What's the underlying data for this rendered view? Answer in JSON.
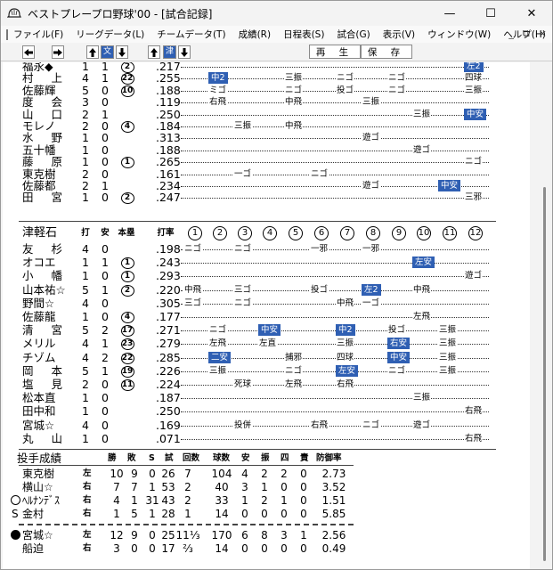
{
  "window": {
    "title": "ベストプレープロ野球'00 - [試合記録]",
    "minimize": "—",
    "maximize": "☐",
    "close": "✕"
  },
  "menu": [
    "ファイル(F)",
    "リーグデータ(L)",
    "チームデータ(T)",
    "成績(R)",
    "日程表(S)",
    "試合(G)",
    "表示(V)",
    "ウィンドウ(W)",
    "ヘルプ(H)"
  ],
  "mdi_controls": [
    "_",
    "⧉",
    "×"
  ],
  "toolbar": {
    "team1": "文",
    "team2": "津",
    "play": "再 生",
    "save": "保 存"
  },
  "top_batters": [
    {
      "name": "福永◆",
      "ab": "1",
      "h": "1",
      "hr": "2",
      "avg": ".217",
      "abs": [
        {
          "inn": 12,
          "t": "左2",
          "hl": true
        }
      ]
    },
    {
      "name": "村上",
      "ab": "4",
      "h": "1",
      "hr": "22",
      "avg": ".255",
      "abs": [
        {
          "inn": 2,
          "t": "中2",
          "hl": true
        },
        {
          "inn": 5,
          "t": "三振"
        },
        {
          "inn": 7,
          "t": "ニゴ"
        },
        {
          "inn": 9,
          "t": "ニゴ"
        },
        {
          "inn": 12,
          "t": "四球"
        }
      ]
    },
    {
      "name": "佐藤輝",
      "ab": "5",
      "h": "0",
      "hr": "10",
      "avg": ".188",
      "abs": [
        {
          "inn": 2,
          "t": "ミゴ"
        },
        {
          "inn": 5,
          "t": "ニゴ"
        },
        {
          "inn": 7,
          "t": "投ゴ"
        },
        {
          "inn": 9,
          "t": "ニゴ"
        },
        {
          "inn": 12,
          "t": "三振"
        }
      ]
    },
    {
      "name": "度会",
      "ab": "3",
      "h": "0",
      "hr": "",
      "avg": ".119",
      "abs": [
        {
          "inn": 2,
          "t": "右飛"
        },
        {
          "inn": 5,
          "t": "中飛"
        },
        {
          "inn": 8,
          "t": "三振"
        }
      ]
    },
    {
      "name": "山口",
      "ab": "2",
      "h": "1",
      "hr": "",
      "avg": ".250",
      "abs": [
        {
          "inn": 10,
          "t": "三振"
        },
        {
          "inn": 12,
          "t": "中安",
          "hl": true
        }
      ]
    },
    {
      "name": "モレノ",
      "ab": "2",
      "h": "0",
      "hr": "4",
      "avg": ".184",
      "abs": [
        {
          "inn": 3,
          "t": "三振"
        },
        {
          "inn": 5,
          "t": "中飛"
        }
      ]
    },
    {
      "name": "水野",
      "ab": "1",
      "h": "0",
      "hr": "",
      "avg": ".313",
      "abs": [
        {
          "inn": 8,
          "t": "遊ゴ"
        }
      ]
    },
    {
      "name": "五十幡",
      "ab": "1",
      "h": "0",
      "hr": "",
      "avg": ".188",
      "abs": [
        {
          "inn": 10,
          "t": "遊ゴ"
        }
      ]
    },
    {
      "name": "藤原",
      "ab": "1",
      "h": "0",
      "hr": "1",
      "avg": ".265",
      "abs": [
        {
          "inn": 12,
          "t": "ニゴ"
        }
      ]
    },
    {
      "name": "東克樹",
      "ab": "2",
      "h": "0",
      "hr": "",
      "avg": ".161",
      "abs": [
        {
          "inn": 3,
          "t": "一ゴ"
        },
        {
          "inn": 6,
          "t": "ニゴ"
        }
      ]
    },
    {
      "name": "佐藤都",
      "ab": "2",
      "h": "1",
      "hr": "",
      "avg": ".234",
      "abs": [
        {
          "inn": 8,
          "t": "遊ゴ"
        },
        {
          "inn": 11,
          "t": "中安",
          "hl": true
        }
      ]
    },
    {
      "name": "田宮",
      "ab": "1",
      "h": "0",
      "hr": "2",
      "avg": ".247",
      "abs": [
        {
          "inn": 12,
          "t": "三邪"
        }
      ]
    }
  ],
  "team2": {
    "name": "津軽石",
    "col_ab": "打",
    "col_h": "安",
    "col_hr": "本塁",
    "col_avg": "打率",
    "innings": [
      "1",
      "2",
      "3",
      "4",
      "5",
      "6",
      "7",
      "8",
      "9",
      "10",
      "11",
      "12"
    ]
  },
  "bottom_batters": [
    {
      "name": "友杉",
      "ab": "4",
      "h": "0",
      "hr": "",
      "avg": ".198",
      "abs": [
        {
          "inn": 1,
          "t": "ニゴ"
        },
        {
          "inn": 3,
          "t": "ニゴ"
        },
        {
          "inn": 6,
          "t": "一邪"
        },
        {
          "inn": 8,
          "t": "一邪"
        }
      ]
    },
    {
      "name": "オコエ",
      "ab": "1",
      "h": "1",
      "hr": "1",
      "avg": ".243",
      "abs": [
        {
          "inn": 10,
          "t": "左安",
          "hl": true
        }
      ]
    },
    {
      "name": "小幡",
      "ab": "1",
      "h": "0",
      "hr": "1",
      "avg": ".293",
      "abs": [
        {
          "inn": 12,
          "t": "遊ゴ"
        }
      ]
    },
    {
      "name": "山本祐☆",
      "ab": "5",
      "h": "1",
      "hr": "2",
      "avg": ".220",
      "abs": [
        {
          "inn": 1,
          "t": "中飛"
        },
        {
          "inn": 3,
          "t": "三ゴ"
        },
        {
          "inn": 6,
          "t": "投ゴ"
        },
        {
          "inn": 8,
          "t": "左2",
          "hl": true
        },
        {
          "inn": 10,
          "t": "中飛"
        }
      ]
    },
    {
      "name": "野間☆",
      "ab": "4",
      "h": "0",
      "hr": "",
      "avg": ".305",
      "abs": [
        {
          "inn": 1,
          "t": "三ゴ"
        },
        {
          "inn": 3,
          "t": "ニゴ"
        },
        {
          "inn": 7,
          "t": "中飛"
        },
        {
          "inn": 8,
          "t": "一ゴ"
        }
      ]
    },
    {
      "name": "佐藤龍",
      "ab": "1",
      "h": "0",
      "hr": "4",
      "avg": ".177",
      "abs": [
        {
          "inn": 10,
          "t": "左飛"
        }
      ]
    },
    {
      "name": "清宮",
      "ab": "5",
      "h": "2",
      "hr": "17",
      "avg": ".271",
      "abs": [
        {
          "inn": 2,
          "t": "ニゴ"
        },
        {
          "inn": 4,
          "t": "中安",
          "hl": true
        },
        {
          "inn": 7,
          "t": "中2",
          "hl": true
        },
        {
          "inn": 9,
          "t": "投ゴ"
        },
        {
          "inn": 11,
          "t": "三振"
        }
      ]
    },
    {
      "name": "メリル",
      "ab": "4",
      "h": "1",
      "hr": "23",
      "avg": ".279",
      "abs": [
        {
          "inn": 2,
          "t": "左飛"
        },
        {
          "inn": 4,
          "t": "左直"
        },
        {
          "inn": 7,
          "t": "三振"
        },
        {
          "inn": 9,
          "t": "右安",
          "hl": true
        },
        {
          "inn": 11,
          "t": "三振"
        }
      ]
    },
    {
      "name": "チゾム",
      "ab": "4",
      "h": "2",
      "hr": "22",
      "avg": ".285",
      "abs": [
        {
          "inn": 2,
          "t": "二安",
          "hl": true
        },
        {
          "inn": 5,
          "t": "捕邪"
        },
        {
          "inn": 7,
          "t": "四球"
        },
        {
          "inn": 9,
          "t": "中安",
          "hl": true
        },
        {
          "inn": 11,
          "t": "三振"
        }
      ]
    },
    {
      "name": "岡本",
      "ab": "5",
      "h": "1",
      "hr": "19",
      "avg": ".226",
      "abs": [
        {
          "inn": 2,
          "t": "三振"
        },
        {
          "inn": 5,
          "t": "ニゴ"
        },
        {
          "inn": 7,
          "t": "左安",
          "hl": true
        },
        {
          "inn": 9,
          "t": "ニゴ"
        },
        {
          "inn": 11,
          "t": "三振"
        }
      ]
    },
    {
      "name": "塩見",
      "ab": "2",
      "h": "0",
      "hr": "11",
      "avg": ".224",
      "abs": [
        {
          "inn": 3,
          "t": "死球"
        },
        {
          "inn": 5,
          "t": "左飛"
        },
        {
          "inn": 7,
          "t": "右飛"
        }
      ]
    },
    {
      "name": "松本直",
      "ab": "1",
      "h": "0",
      "hr": "",
      "avg": ".187",
      "abs": [
        {
          "inn": 10,
          "t": "三振"
        }
      ]
    },
    {
      "name": "田中和",
      "ab": "1",
      "h": "0",
      "hr": "",
      "avg": ".250",
      "abs": [
        {
          "inn": 12,
          "t": "右飛"
        }
      ]
    },
    {
      "name": "宮城☆",
      "ab": "4",
      "h": "0",
      "hr": "",
      "avg": ".169",
      "abs": [
        {
          "inn": 3,
          "t": "投併"
        },
        {
          "inn": 6,
          "t": "右飛"
        },
        {
          "inn": 8,
          "t": "ニゴ"
        },
        {
          "inn": 10,
          "t": "遊ゴ"
        }
      ]
    },
    {
      "name": "丸山",
      "ab": "1",
      "h": "0",
      "hr": "",
      "avg": ".071",
      "abs": [
        {
          "inn": 12,
          "t": "右飛"
        }
      ]
    }
  ],
  "pitching": {
    "title": "投手成績",
    "headers": [
      "勝",
      "敗",
      "S",
      "試",
      "回数",
      "球数",
      "安",
      "振",
      "四",
      "責",
      "防御率"
    ],
    "top": [
      {
        "mark": "",
        "name": "東克樹",
        "hand": "左",
        "w": "10",
        "l": "9",
        "s": "0",
        "g": "26",
        "ip": "7",
        "np": "104",
        "h": "4",
        "so": "2",
        "bb": "2",
        "er": "0",
        "era": "2.73"
      },
      {
        "mark": "",
        "name": "横山☆",
        "hand": "右",
        "w": "7",
        "l": "7",
        "s": "1",
        "g": "53",
        "ip": "2",
        "np": "40",
        "h": "3",
        "so": "1",
        "bb": "0",
        "er": "0",
        "era": "3.52"
      },
      {
        "mark": "○",
        "name": "ﾍﾙﾅﾝﾃﾞｽ",
        "hand": "右",
        "w": "4",
        "l": "1",
        "s": "31",
        "g": "43",
        "ip": "2",
        "np": "33",
        "h": "1",
        "so": "2",
        "bb": "1",
        "er": "0",
        "era": "1.51"
      },
      {
        "mark": "S",
        "name": "金村",
        "hand": "右",
        "w": "1",
        "l": "5",
        "s": "1",
        "g": "28",
        "ip": "1",
        "np": "14",
        "h": "0",
        "so": "0",
        "bb": "0",
        "er": "0",
        "era": "5.85"
      }
    ],
    "bottom": [
      {
        "mark": "●",
        "name": "宮城☆",
        "hand": "左",
        "w": "12",
        "l": "9",
        "s": "0",
        "g": "25",
        "ip": "11⅓",
        "np": "170",
        "h": "6",
        "so": "8",
        "bb": "3",
        "er": "1",
        "era": "2.56"
      },
      {
        "mark": "",
        "name": "船迫",
        "hand": "右",
        "w": "3",
        "l": "0",
        "s": "0",
        "g": "17",
        "ip": "⅔",
        "np": "14",
        "h": "0",
        "so": "0",
        "bb": "0",
        "er": "0",
        "era": "0.49"
      }
    ]
  }
}
